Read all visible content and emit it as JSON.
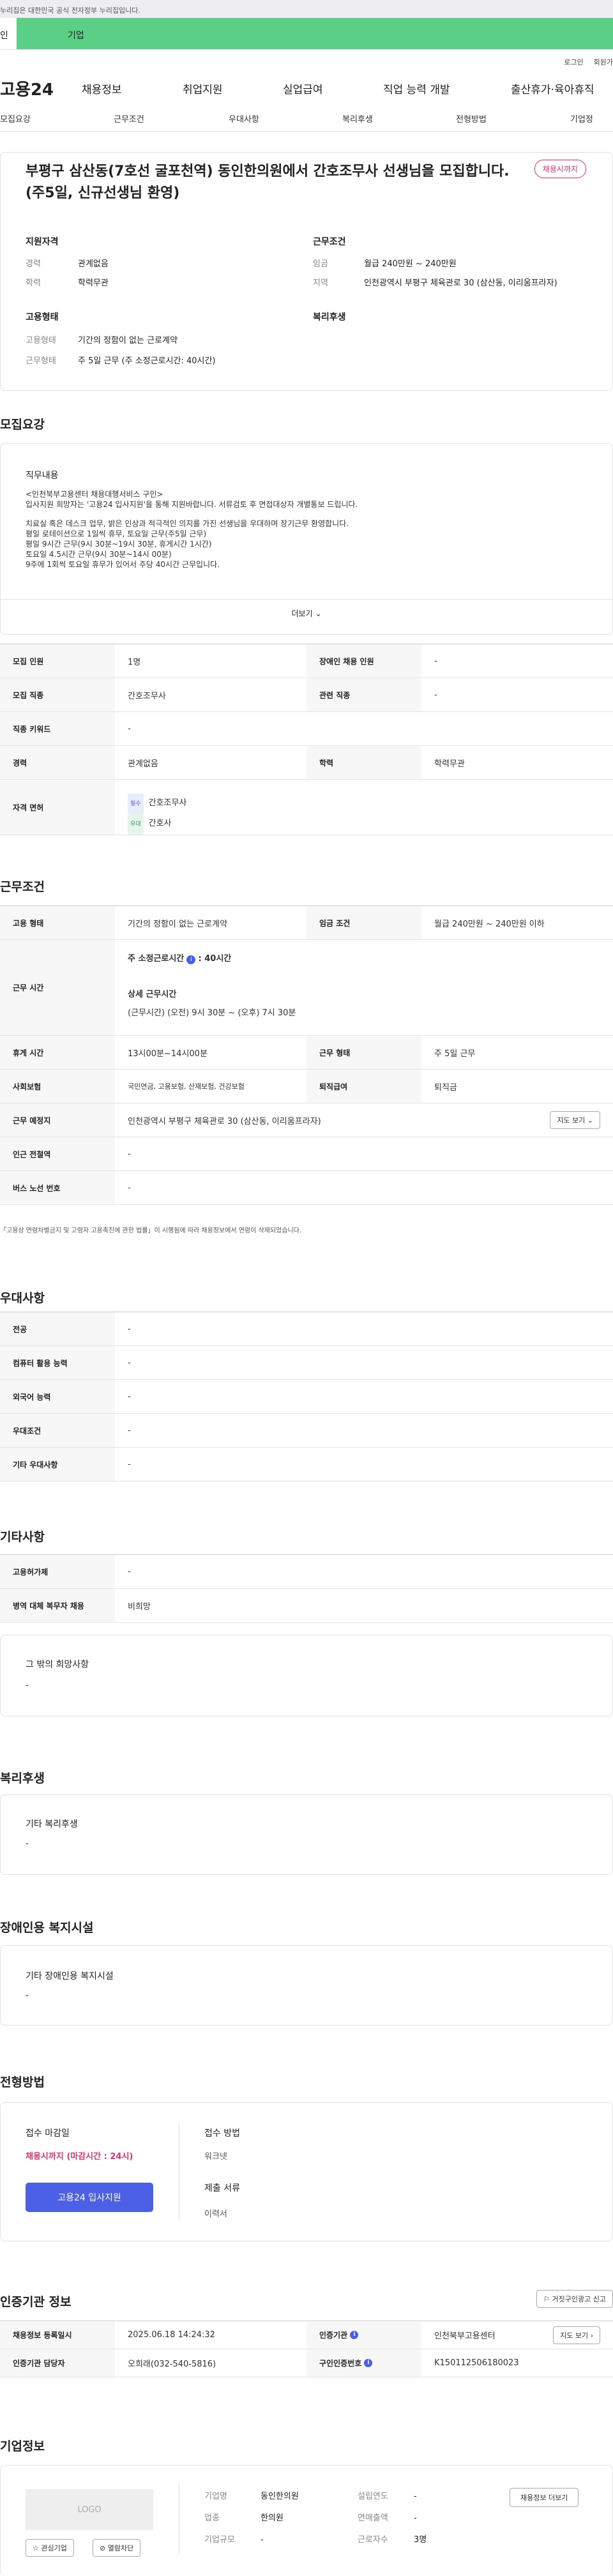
{
  "gov_banner": "누리집은 대한민국 공식 전자정부 누리집입니다.",
  "topbar": {
    "a": "인",
    "b": "기업"
  },
  "util": {
    "login": "로그인",
    "join": "회원가"
  },
  "logo": "고용24",
  "gnb": [
    "채용정보",
    "취업지원",
    "실업급여",
    "직업 능력 개발",
    "출산휴가·육아휴직"
  ],
  "lnb": [
    "모집요강",
    "근무조건",
    "우대사항",
    "복리후생",
    "전형방법",
    "기업정"
  ],
  "job": {
    "title": "부평구 삼산동(7호선 굴포천역) 동인한의원에서 간호조무사 선생님을 모집합니다.(주5일, 신규선생님 환영)",
    "badge": "채용시까지",
    "qual_h": "지원자격",
    "career_k": "경력",
    "career_v": "관계없음",
    "edu_k": "학력",
    "edu_v": "학력무관",
    "cond_h": "근무조건",
    "wage_k": "임금",
    "wage_v": "월급 240만원 ~ 240만원",
    "area_k": "지역",
    "area_v": "인천광역시 부평구 체육관로 30 (삼산동, 이리움프라자)",
    "emp_h": "고용형태",
    "etype_k": "고용형태",
    "etype_v": "기간의 정함이 없는 근로계약",
    "wtype_k": "근무형태",
    "wtype_v": "주 5일 근무 (주 소정근로시간: 40시간)",
    "welfare_h": "복리후생"
  },
  "recruit": {
    "title": "모집요강",
    "duty_h": "직무내용",
    "lines": [
      "<인천북부고용센터 채용대행서비스 구인>",
      "입사지원 희망자는 '고용24 입사지원'을 통해 지원바랍니다. 서류검토 후 면접대상자 개별통보 드립니다.",
      "치료실 혹은 데스크 업무, 밝은 인상과 적극적인 의지를 가진 선생님을 우대하며 장기근무 환영합니다.",
      "평일 로테이션으로 1일씩 휴무, 토요일 근무(주5일 근무)",
      "평일 9시간 근무(9시 30분~19시 30분, 휴게시간 1시간)",
      "토요일 4.5시간 근무(9시 30분~14시 00분)",
      "9주에 1회씩 토요일 휴무가 있어서 주당 40시간 근무입니다."
    ],
    "more": "더보기",
    "rows": {
      "cnt_k": "모집 인원",
      "cnt_v": "1명",
      "dis_k": "장애인 채용 인원",
      "dis_v": "-",
      "job_k": "모집 직종",
      "job_v": "간호조무사",
      "rel_k": "관련 직종",
      "rel_v": "-",
      "kw_k": "직종 키워드",
      "kw_v": "-",
      "car_k": "경력",
      "car_v": "관계없음",
      "edu_k": "학력",
      "edu_v": "학력무관",
      "lic_k": "자격 면허",
      "lic_tag1": "필수",
      "lic_v1": "간호조무사",
      "lic_tag2": "우대",
      "lic_v2": "간호사"
    }
  },
  "work": {
    "title": "근무조건",
    "emp_k": "고용 형태",
    "emp_v": "기간의 정함이 없는 근로계약",
    "wage_k": "임금 조건",
    "wage_v": "월급 240만원 ~ 240만원 이하",
    "time_k": "근무 시간",
    "time_a": "주 소정근로시간",
    "time_a_v": ": 40시간",
    "time_b": "상세 근무시간",
    "time_b_v": "(근무시간) (오전) 9시 30분 ~ (오후) 7시 30분",
    "rest_k": "휴게 시간",
    "rest_v": "13시00분~14시00분",
    "form_k": "근무 형태",
    "form_v": "주 5일 근무",
    "ins_k": "사회보험",
    "ins_v": "국민연금, 고용보험, 산재보험, 건강보험",
    "sev_k": "퇴직급여",
    "sev_v": "퇴직금",
    "loc_k": "근무 예정지",
    "loc_v": "인천광역시 부평구 체육관로 30 (삼산동, 이리움프라자)",
    "map": "지도 보기",
    "sub_k": "인근 전철역",
    "sub_v": "-",
    "bus_k": "버스 노선 번호",
    "bus_v": "-",
    "note": "「고용상 연령차별금지 및 고령자 고용촉진에 관한 법률」이 시행됨에 따라 채용정보에서 연령이 삭제되었습니다."
  },
  "pref": {
    "title": "우대사항",
    "r": [
      [
        "전공",
        "-"
      ],
      [
        "컴퓨터 활용 능력",
        "-"
      ],
      [
        "외국어 능력",
        "-"
      ],
      [
        "우대조건",
        "-"
      ],
      [
        "기타 우대사항",
        "-"
      ]
    ]
  },
  "etc": {
    "title": "기타사항",
    "r": [
      [
        "고용허가제",
        "-"
      ],
      [
        "병역 대체 복무자 채용",
        "비희망"
      ]
    ],
    "other_h": "그 밖의 희망사항",
    "other_v": "-"
  },
  "welfare": {
    "title": "복리후생",
    "h": "기타 복리후생",
    "v": "-"
  },
  "disab": {
    "title": "장애인용 복지시설",
    "h": "기타 장애인용 복지시설",
    "v": "-"
  },
  "selection": {
    "title": "전형방법",
    "deadline_h": "접수 마감일",
    "deadline_v": "채용시까지 (마감시간 : 24시)",
    "apply": "고용24 입사지원",
    "method_h": "접수 방법",
    "method_v": "워크넷",
    "docs_h": "제출 서류",
    "docs_v": "이력서"
  },
  "cert": {
    "title": "인증기관 정보",
    "report": "거짓구인광고 신고",
    "r1k": "채용정보 등록일시",
    "r1v": "2025.06.18 14:24:32",
    "r1k2": "인증기관",
    "r1v2": "인천북부고용센터",
    "map": "지도 보기",
    "r2k": "인증기관 담당자",
    "r2v": "오희래(032-540-5816)",
    "r2k2": "구인인증번호",
    "r2v2": "K150112506180023"
  },
  "company": {
    "title": "기업정보",
    "logo": "LOGO",
    "fav": "관심기업",
    "block": "열람차단",
    "name_k": "기업명",
    "name_v": "동인한의원",
    "found_k": "설립연도",
    "found_v": "-",
    "ind_k": "업종",
    "ind_v": "한의원",
    "sales_k": "연매출액",
    "sales_v": "-",
    "size_k": "기업규모",
    "size_v": "-",
    "emp_k": "근로자수",
    "emp_v": "3명",
    "list": "채용정보 더보기"
  }
}
